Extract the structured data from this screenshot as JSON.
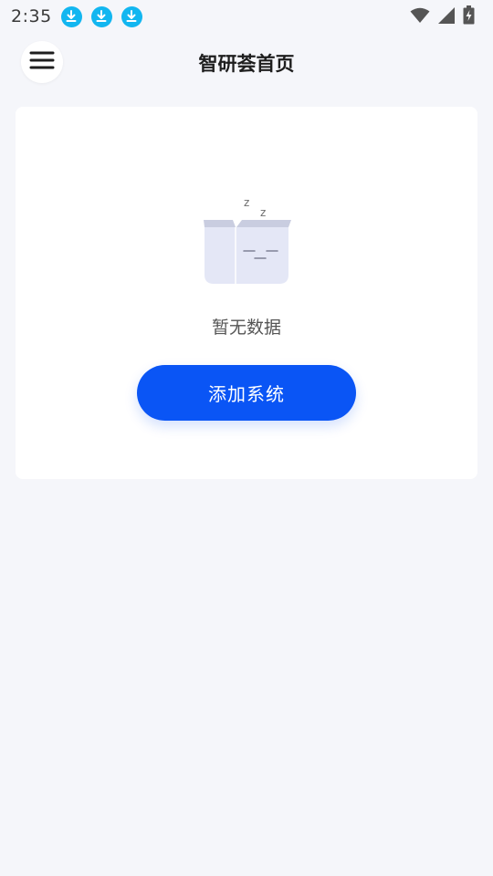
{
  "status_bar": {
    "time": "2:35",
    "notifications": [
      "download-icon",
      "download-icon",
      "download-icon"
    ],
    "right_icons": [
      "wifi-icon",
      "signal-icon",
      "battery-charging-icon"
    ]
  },
  "header": {
    "title": "智研荟首页",
    "menu_icon": "hamburger-menu-icon"
  },
  "empty_state": {
    "illustration": "sleeping-empty-box-icon",
    "message": "暂无数据"
  },
  "actions": {
    "add_system_label": "添加系统"
  },
  "colors": {
    "background": "#f5f6fa",
    "primary": "#0a55f5",
    "download_badge": "#12b6f0"
  }
}
